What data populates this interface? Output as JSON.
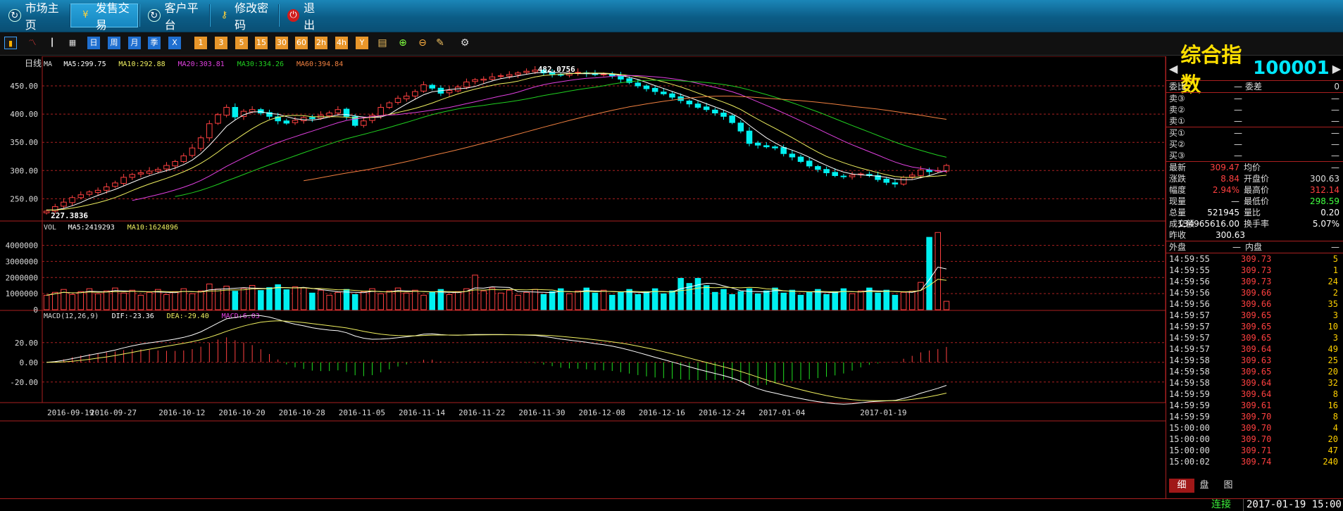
{
  "nav": {
    "items": [
      {
        "label": "市场主页",
        "icon": "refresh-icon"
      },
      {
        "label": "发售交易",
        "icon": "yen-icon"
      },
      {
        "label": "客户平台",
        "icon": "refresh-icon"
      },
      {
        "label": "修改密码",
        "icon": "key-icon"
      },
      {
        "label": "退　　出",
        "icon": "power-icon"
      }
    ],
    "active_index": 1
  },
  "toolbar": {
    "buttons": [
      {
        "label": "",
        "icon": "bar-chart-icon"
      },
      {
        "label": "",
        "icon": "line-chart-icon"
      },
      {
        "label": "",
        "icon": "candle-icon"
      },
      {
        "label": "",
        "icon": "calendar-icon"
      },
      {
        "label": "日",
        "icon": ""
      },
      {
        "label": "周",
        "icon": ""
      },
      {
        "label": "月",
        "icon": ""
      },
      {
        "label": "季",
        "icon": ""
      },
      {
        "label": "X",
        "icon": ""
      },
      {
        "label": "1",
        "icon": ""
      },
      {
        "label": "3",
        "icon": ""
      },
      {
        "label": "5",
        "icon": ""
      },
      {
        "label": "15",
        "icon": ""
      },
      {
        "label": "30",
        "icon": ""
      },
      {
        "label": "60",
        "icon": ""
      },
      {
        "label": "2h",
        "icon": ""
      },
      {
        "label": "4h",
        "icon": ""
      },
      {
        "label": "Y",
        "icon": ""
      },
      {
        "label": "",
        "icon": "notes-icon"
      },
      {
        "label": "",
        "icon": "zoom-in-icon"
      },
      {
        "label": "",
        "icon": "zoom-out-icon"
      },
      {
        "label": "",
        "icon": "draw-icon"
      },
      {
        "label": "",
        "icon": "gear-icon"
      }
    ]
  },
  "colors": {
    "up": "#ff4040",
    "down": "#00f0f0",
    "grid": "#aa2020",
    "ma5": "#ffffff",
    "ma10": "#f0f060",
    "ma20": "#e040e0",
    "ma30": "#20d020",
    "ma60": "#f08040"
  },
  "chart_data": [
    {
      "type": "candlestick",
      "period_label": "日线",
      "legend": [
        {
          "text": "MA",
          "color": "#dddddd"
        },
        {
          "text": "MA5:299.75",
          "color": "#ffffff"
        },
        {
          "text": "MA10:292.88",
          "color": "#f0f060"
        },
        {
          "text": "MA20:303.81",
          "color": "#e040e0"
        },
        {
          "text": "MA30:334.26",
          "color": "#20d020"
        },
        {
          "text": "MA60:394.84",
          "color": "#f08040"
        }
      ],
      "y_ticks": [
        "450.00",
        "400.00",
        "350.00",
        "300.00",
        "250.00"
      ],
      "y_tick_values": [
        450,
        400,
        350,
        300,
        250
      ],
      "ylim": [
        228,
        480
      ],
      "high_marker": "482.0756",
      "low_marker": "227.3836",
      "closes": [
        228,
        236,
        244,
        252,
        257,
        262,
        265,
        271,
        278,
        288,
        293,
        296,
        299,
        302,
        309,
        316,
        326,
        340,
        358,
        383,
        399,
        412,
        395,
        405,
        408,
        402,
        396,
        388,
        384,
        389,
        394,
        392,
        398,
        402,
        408,
        396,
        380,
        388,
        398,
        412,
        420,
        428,
        432,
        440,
        452,
        446,
        437,
        442,
        448,
        457,
        461,
        462,
        466,
        468,
        470,
        473,
        476,
        478,
        473,
        471,
        469,
        472,
        474,
        472,
        470,
        471,
        468,
        462,
        456,
        450,
        445,
        440,
        436,
        430,
        424,
        418,
        412,
        408,
        402,
        396,
        385,
        370,
        348,
        345,
        342,
        340,
        330,
        324,
        316,
        308,
        302,
        296,
        291,
        289,
        292,
        294,
        291,
        284,
        279,
        276,
        288,
        292,
        301,
        298,
        300,
        309
      ],
      "ma5_end": 299.75,
      "ma10_end": 292.88,
      "ma20_end": 303.81,
      "ma30_end": 334.26,
      "ma60_end": 394.84
    },
    {
      "type": "bar",
      "title": "VOL",
      "legend": [
        {
          "text": "VOL",
          "color": "#dddddd"
        },
        {
          "text": "MA5:2419293",
          "color": "#ffffff"
        },
        {
          "text": "MA10:1624896",
          "color": "#f0f060"
        }
      ],
      "y_ticks": [
        "4000000",
        "3000000",
        "2000000",
        "1000000",
        "0"
      ],
      "y_tick_values": [
        4000000,
        3000000,
        2000000,
        1000000,
        0
      ],
      "ylim": [
        0,
        4900000
      ],
      "last_values": [
        4500000,
        4800000,
        521945,
        521945
      ]
    },
    {
      "type": "line",
      "title": "MACD",
      "legend": [
        {
          "text": "MACD(12,26,9)",
          "color": "#dddddd"
        },
        {
          "text": "DIF:-23.36",
          "color": "#ffffff"
        },
        {
          "text": "DEA:-29.40",
          "color": "#f0f060"
        },
        {
          "text": "MACD:6.03",
          "color": "#e040e0"
        }
      ],
      "y_ticks": [
        "20.00",
        "0.00",
        "-20.00"
      ],
      "y_tick_values": [
        20,
        0,
        -20
      ],
      "ylim": [
        -38,
        42
      ],
      "dif_end": -23.36,
      "dea_end": -29.4,
      "macd_end": 6.03
    }
  ],
  "x_dates": [
    "2016-09-19",
    "2016-09-27",
    "2016-10-12",
    "2016-10-20",
    "2016-10-28",
    "2016-11-05",
    "2016-11-14",
    "2016-11-22",
    "2016-11-30",
    "2016-12-08",
    "2016-12-16",
    "2016-12-24",
    "2017-01-04",
    "2017-01-19"
  ],
  "x_date_index": [
    0,
    5,
    13,
    20,
    27,
    34,
    41,
    48,
    55,
    62,
    69,
    76,
    83,
    96
  ],
  "panel": {
    "title_name": "综合指数",
    "title_code": "100001",
    "wb": {
      "label1": "委比",
      "v1": "—",
      "label2": "委差",
      "v2": "0"
    },
    "sells": [
      {
        "label": "卖③",
        "price": "—",
        "vol": "—"
      },
      {
        "label": "卖②",
        "price": "—",
        "vol": "—"
      },
      {
        "label": "卖①",
        "price": "—",
        "vol": "—"
      }
    ],
    "buys": [
      {
        "label": "买①",
        "price": "—",
        "vol": "—"
      },
      {
        "label": "买②",
        "price": "—",
        "vol": "—"
      },
      {
        "label": "买③",
        "price": "—",
        "vol": "—"
      }
    ],
    "quotes": [
      {
        "l1": "最新",
        "v1": "309.47",
        "c1": "#ff4040",
        "l2": "均价",
        "v2": "—",
        "c2": "#dddddd"
      },
      {
        "l1": "涨跌",
        "v1": "8.84",
        "c1": "#ff4040",
        "l2": "开盘价",
        "v2": "300.63",
        "c2": "#dddddd"
      },
      {
        "l1": "幅度",
        "v1": "2.94%",
        "c1": "#ff4040",
        "l2": "最高价",
        "v2": "312.14",
        "c2": "#ff4040"
      },
      {
        "l1": "现量",
        "v1": "—",
        "c1": "#dddddd",
        "l2": "最低价",
        "v2": "298.59",
        "c2": "#40ff40"
      },
      {
        "l1": "总量",
        "v1": "521945",
        "c1": "#ffffff",
        "l2": "量比",
        "v2": "0.20",
        "c2": "#ffffff"
      },
      {
        "l1": "成交额",
        "v1": "134965616.00",
        "c1": "#ffffff",
        "l2": "换手率",
        "v2": "5.07%",
        "c2": "#ffffff"
      }
    ],
    "prev_close": {
      "label": "昨收",
      "value": "300.63"
    },
    "outin": {
      "label1": "外盘",
      "v1": "—",
      "label2": "内盘",
      "v2": "—"
    },
    "ticks": [
      {
        "t": "14:59:55",
        "p": "309.73",
        "v": "5"
      },
      {
        "t": "14:59:55",
        "p": "309.73",
        "v": "1"
      },
      {
        "t": "14:59:56",
        "p": "309.73",
        "v": "24"
      },
      {
        "t": "14:59:56",
        "p": "309.66",
        "v": "2"
      },
      {
        "t": "14:59:56",
        "p": "309.66",
        "v": "35"
      },
      {
        "t": "14:59:57",
        "p": "309.65",
        "v": "3"
      },
      {
        "t": "14:59:57",
        "p": "309.65",
        "v": "10"
      },
      {
        "t": "14:59:57",
        "p": "309.65",
        "v": "3"
      },
      {
        "t": "14:59:57",
        "p": "309.64",
        "v": "49"
      },
      {
        "t": "14:59:58",
        "p": "309.63",
        "v": "25"
      },
      {
        "t": "14:59:58",
        "p": "309.65",
        "v": "20"
      },
      {
        "t": "14:59:58",
        "p": "309.64",
        "v": "32"
      },
      {
        "t": "14:59:59",
        "p": "309.64",
        "v": "8"
      },
      {
        "t": "14:59:59",
        "p": "309.61",
        "v": "16"
      },
      {
        "t": "14:59:59",
        "p": "309.70",
        "v": "8"
      },
      {
        "t": "15:00:00",
        "p": "309.70",
        "v": "4"
      },
      {
        "t": "15:00:00",
        "p": "309.70",
        "v": "20"
      },
      {
        "t": "15:00:00",
        "p": "309.71",
        "v": "47"
      },
      {
        "t": "15:00:02",
        "p": "309.74",
        "v": "240"
      }
    ],
    "tabs": [
      "细",
      "盘",
      "图"
    ]
  },
  "status": {
    "connection": "连接",
    "datetime": "2017-01-19 15:00"
  }
}
